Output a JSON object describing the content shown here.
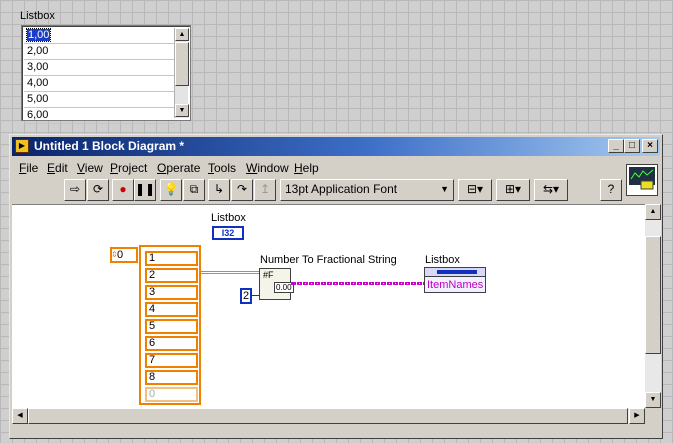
{
  "front_panel": {
    "listbox_label": "Listbox",
    "items": [
      "1,00",
      "2,00",
      "3,00",
      "4,00",
      "5,00",
      "6,00"
    ],
    "selected_index": 0
  },
  "window": {
    "title": "Untitled 1 Block Diagram *",
    "controls": {
      "minimize": "_",
      "maximize": "□",
      "close": "×"
    }
  },
  "menu": {
    "items": [
      {
        "label": "File",
        "accel": "F"
      },
      {
        "label": "Edit",
        "accel": "E"
      },
      {
        "label": "View",
        "accel": "V"
      },
      {
        "label": "Project",
        "accel": "P"
      },
      {
        "label": "Operate",
        "accel": "O"
      },
      {
        "label": "Tools",
        "accel": "T"
      },
      {
        "label": "Window",
        "accel": "W"
      },
      {
        "label": "Help",
        "accel": "H"
      }
    ]
  },
  "toolbar": {
    "font": "13pt Application Font",
    "icons": [
      "run-arrow-icon",
      "run-continuously-icon",
      "abort-icon",
      "pause-icon",
      "highlight-execution-icon",
      "retain-wire-values-icon",
      "step-into-icon",
      "step-over-icon",
      "step-out-icon",
      "align-icon",
      "distribute-icon",
      "reorder-icon",
      "help-icon"
    ]
  },
  "diagram": {
    "listbox_terminal_label": "Listbox",
    "listbox_terminal_type": "I32",
    "index_value": "0",
    "array_values": [
      "1",
      "2",
      "3",
      "4",
      "5",
      "6",
      "7",
      "8",
      "0"
    ],
    "function_label": "Number To Fractional String",
    "precision_constant": "2",
    "property_node_label": "Listbox",
    "property_name": "ItemNames"
  },
  "colors": {
    "titlebar_start": "#0a246a",
    "titlebar_end": "#a6caf0",
    "array_orange": "#f08000",
    "integer_blue": "#1030c0",
    "string_pink": "#d000d0",
    "selection_blue": "#1a3cc8"
  }
}
